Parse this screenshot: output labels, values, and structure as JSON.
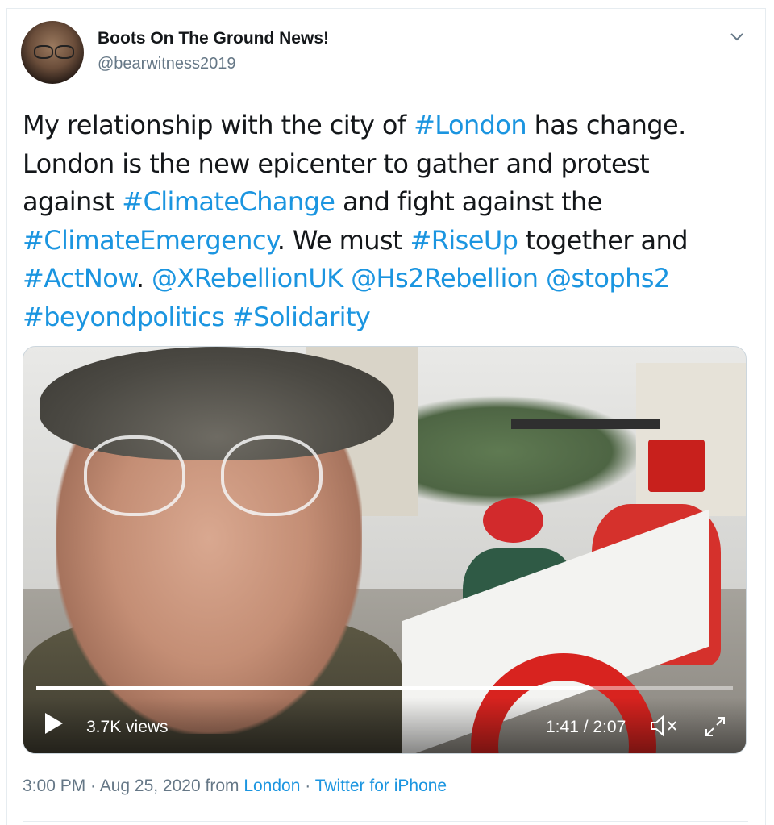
{
  "author": {
    "name": "Boots On The Ground News!",
    "handle": "@bearwitness2019"
  },
  "tweet": {
    "segments": [
      {
        "text": "My relationship with the city of ",
        "type": "text"
      },
      {
        "text": "#London",
        "type": "tag"
      },
      {
        "text": " has change. London is the new epicenter to gather and protest against ",
        "type": "text"
      },
      {
        "text": "#ClimateChange",
        "type": "tag"
      },
      {
        "text": " and fight against the ",
        "type": "text"
      },
      {
        "text": "#ClimateEmergency",
        "type": "tag"
      },
      {
        "text": ". We must ",
        "type": "text"
      },
      {
        "text": "#RiseUp",
        "type": "tag"
      },
      {
        "text": " together and ",
        "type": "text"
      },
      {
        "text": "#ActNow",
        "type": "tag"
      },
      {
        "text": ". ",
        "type": "text"
      },
      {
        "text": "@XRebellionUK",
        "type": "mention"
      },
      {
        "text": " ",
        "type": "text"
      },
      {
        "text": "@Hs2Rebellion",
        "type": "mention"
      },
      {
        "text": " ",
        "type": "text"
      },
      {
        "text": "@stophs2",
        "type": "mention"
      },
      {
        "text": " ",
        "type": "text"
      },
      {
        "text": "#beyondpolitics",
        "type": "tag"
      },
      {
        "text": " ",
        "type": "text"
      },
      {
        "text": "#Solidarity",
        "type": "tag"
      }
    ]
  },
  "video": {
    "views": "3.7K views",
    "time": "1:41 / 2:07",
    "progress_fraction": 0.795
  },
  "meta": {
    "time_date": "3:00 PM · Aug 25, 2020 from ",
    "location": "London",
    "separator": " · ",
    "source": "Twitter for iPhone"
  },
  "colors": {
    "link": "#1b95e0",
    "secondary_text": "#657786"
  },
  "icons": [
    "chevron-down-icon",
    "play-icon",
    "mute-icon",
    "fullscreen-icon"
  ]
}
